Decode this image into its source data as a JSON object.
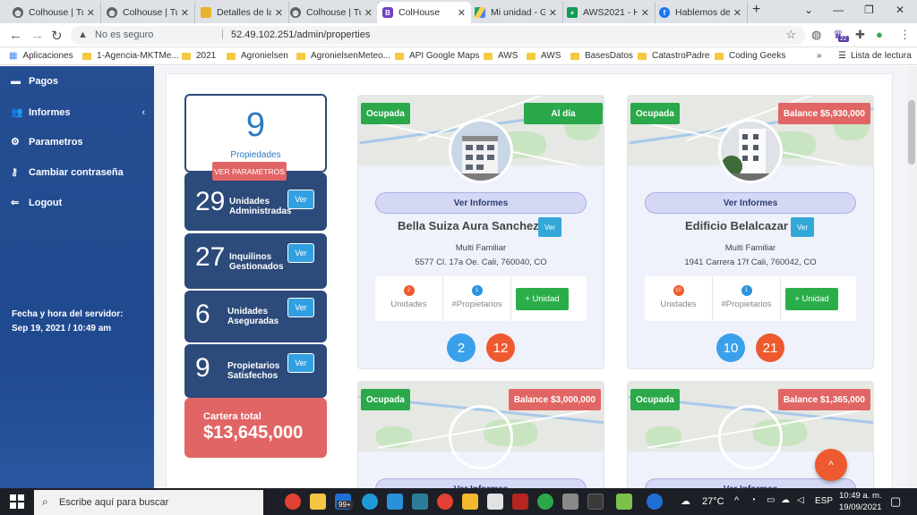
{
  "browser": {
    "tabs": [
      {
        "label": "Colhouse | Tu",
        "icon": "globe-icon",
        "active": false
      },
      {
        "label": "Colhouse | Tu",
        "icon": "globe-icon",
        "active": false
      },
      {
        "label": "Detalles de la",
        "icon": "box-icon",
        "active": false
      },
      {
        "label": "Colhouse | Tu",
        "icon": "globe-icon",
        "active": false
      },
      {
        "label": "ColHouse",
        "icon": "bootstrap-icon",
        "active": true
      },
      {
        "label": "Mi unidad - G",
        "icon": "drive-icon",
        "active": false
      },
      {
        "label": "AWS2021 - H",
        "icon": "sheets-icon",
        "active": false
      },
      {
        "label": "Hablemos de",
        "icon": "facebook-icon",
        "active": false
      }
    ],
    "new_tab": "+",
    "not_secure": "No es seguro",
    "url": "52.49.102.251/admin/properties",
    "bookmarks": [
      "Aplicaciones",
      "1-Agencia-MKTMe...",
      "2021",
      "Agronielsen",
      "AgronielsenMeteo...",
      "API Google Maps",
      "AWS",
      "AWS",
      "BasesDatos",
      "CatastroPadre",
      "Coding Geeks"
    ],
    "bookmarks_more": "»",
    "reading_list": "Lista de lectura",
    "ext_badge": "22"
  },
  "sidebar": {
    "items": [
      {
        "label": "Pagos",
        "icon": "money-icon"
      },
      {
        "label": "Informes",
        "icon": "users-icon"
      },
      {
        "label": "Parametros",
        "icon": "cogs-icon"
      },
      {
        "label": "Cambiar contraseña",
        "icon": "key-icon"
      },
      {
        "label": "Logout",
        "icon": "logout-icon"
      }
    ],
    "server_label": "Fecha y hora del servidor:",
    "server_time": "Sep 19, 2021 / 10:49 am"
  },
  "stats": {
    "properties_count": "9",
    "properties_label": "Propiedades",
    "params_button": "VER PARAMETROS",
    "rows": [
      {
        "n": "29",
        "l1": "Unidades",
        "l2": "Administradas",
        "btn": "Ver"
      },
      {
        "n": "27",
        "l1": "Inquilinos",
        "l2": "Gestionados",
        "btn": "Ver"
      },
      {
        "n": "6",
        "l1": "Unidades",
        "l2": "Aseguradas",
        "btn": "Ver"
      },
      {
        "n": "9",
        "l1": "Propietarios",
        "l2": "Satisfechos",
        "btn": "Ver"
      }
    ],
    "portfolio_label": "Cartera total",
    "portfolio_value": "$13,645,000"
  },
  "cards": [
    {
      "status": "Ocupada",
      "balance": "Al día",
      "balance_color": "#2ba84a",
      "ver_informes": "Ver Informes",
      "name": "Bella Suiza Aura Sanchez",
      "ver": "Ver",
      "type": "Multi Familiar",
      "address": "5577 Cl. 17a Oe. Cali, 760040, CO",
      "units": "2",
      "units_label": "Unidades",
      "owners": "1",
      "owners_label": "#Propietarios",
      "add_unit": "+ Unidad",
      "c1": "2",
      "c2": "12"
    },
    {
      "status": "Ocupada",
      "balance": "Balance $5,930,000",
      "balance_color": "#e26565",
      "ver_informes": "Ver Informes",
      "name": "Edificio Belalcazar",
      "ver": "Ver",
      "type": "Multi Familiar",
      "address": "1941 Carrera 17f Cali, 760042, CO",
      "units": "10",
      "units_label": "Unidades",
      "owners": "1",
      "owners_label": "#Propietarios",
      "add_unit": "+ Unidad",
      "c1": "10",
      "c2": "21"
    },
    {
      "status": "Ocupada",
      "balance": "Balance $3,000,000",
      "balance_color": "#e26565",
      "ver_informes": "Ver Informes"
    },
    {
      "status": "Ocupada",
      "balance": "Balance $1,365,000",
      "balance_color": "#e26565",
      "ver_informes": "Ver Informes"
    }
  ],
  "taskbar": {
    "search_placeholder": "Escribe aquí para buscar",
    "mail_badge": "99+",
    "weather": "27°C",
    "lang": "ESP",
    "time": "10:49 a. m.",
    "date": "19/09/2021"
  }
}
